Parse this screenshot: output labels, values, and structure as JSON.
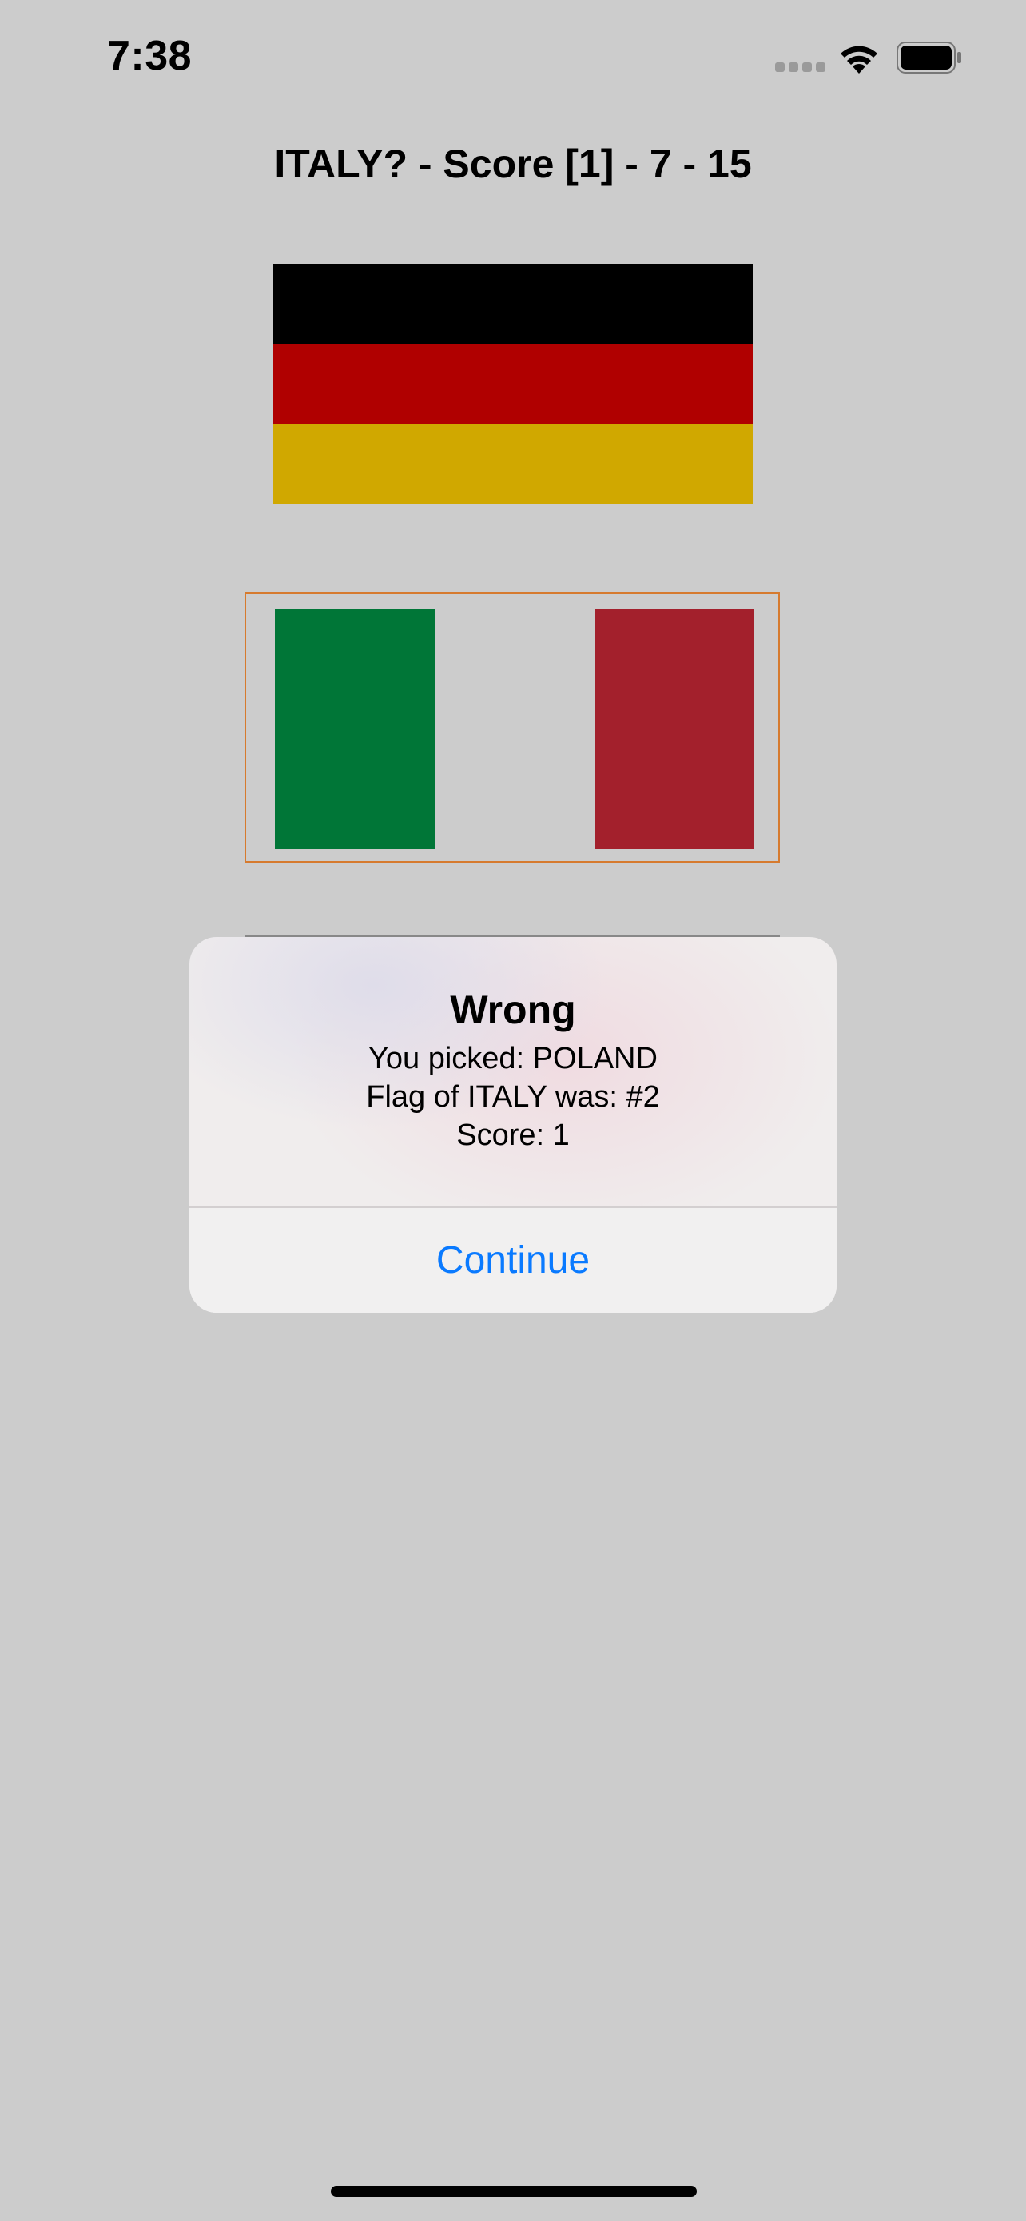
{
  "status_bar": {
    "time": "7:38"
  },
  "header": {
    "title": "ITALY? - Score [1] - 7 - 15"
  },
  "flags": [
    {
      "country": "Germany",
      "stripes": [
        "#000000",
        "#b00000",
        "#d0a800"
      ],
      "orientation": "horizontal",
      "selected": false
    },
    {
      "country": "Italy",
      "stripes": [
        "#007637",
        "#cccccc",
        "#a3202c"
      ],
      "orientation": "vertical",
      "selected": true,
      "highlight_color": "#d67a2e"
    }
  ],
  "alert": {
    "title": "Wrong",
    "lines": [
      "You picked: POLAND",
      "Flag of ITALY was: #2",
      "Score: 1"
    ],
    "button_label": "Continue",
    "button_color": "#0a7aff"
  },
  "icons": [
    "signal-icon",
    "wifi-icon",
    "battery-icon"
  ],
  "colors": {
    "background": "#cccccc",
    "accent": "#0a7aff"
  }
}
